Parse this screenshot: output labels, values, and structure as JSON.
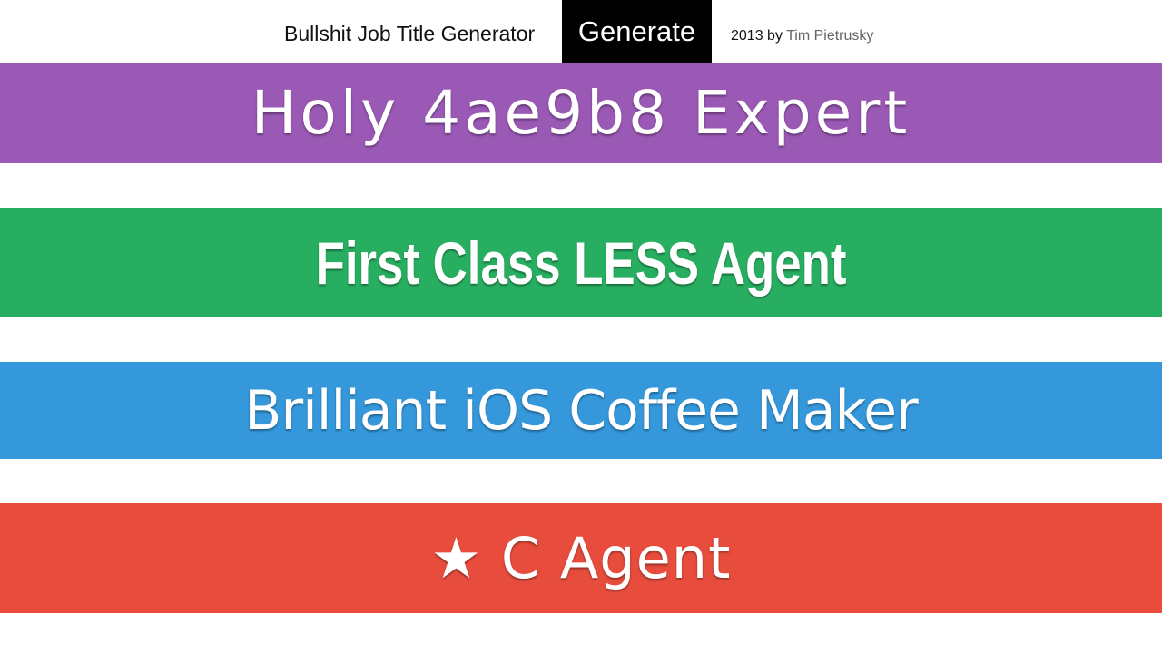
{
  "header": {
    "site_title": "Bullshit Job Title Generator",
    "generate_label": "Generate",
    "credit_prefix": "2013 by",
    "credit_author": "Tim Pietrusky"
  },
  "titles": [
    {
      "text": "Holy 4ae9b8 Expert",
      "color": "#9b59b6"
    },
    {
      "text": "First Class LESS Agent",
      "color": "#27ae60"
    },
    {
      "text": "Brilliant iOS Coffee Maker",
      "color": "#3498db"
    },
    {
      "text": "★ C Agent",
      "color": "#e74c3c"
    }
  ]
}
